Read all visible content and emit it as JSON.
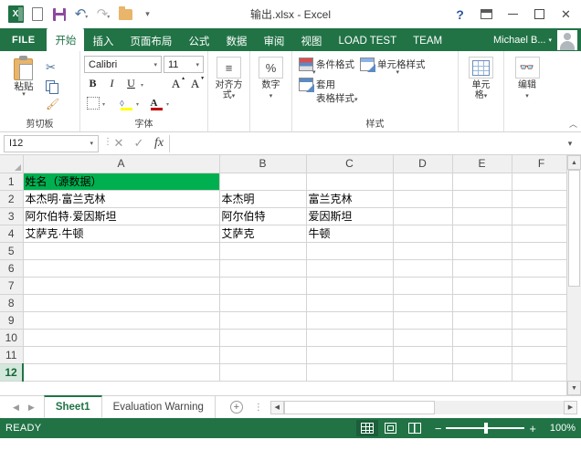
{
  "titlebar": {
    "document_title": "输出.xlsx - Excel",
    "qat": [
      {
        "name": "excel-logo",
        "label": "X"
      },
      {
        "name": "new-file",
        "label": ""
      },
      {
        "name": "save",
        "label": ""
      },
      {
        "name": "undo",
        "label": "↶"
      },
      {
        "name": "redo",
        "label": "↷"
      },
      {
        "name": "open",
        "label": ""
      }
    ],
    "qat_more": "▾",
    "help": "?",
    "minimize": "",
    "maximize": "",
    "close": "✕"
  },
  "ribbon_tabs": {
    "file": "FILE",
    "tabs": [
      {
        "label": "开始",
        "active": true
      },
      {
        "label": "插入",
        "active": false
      },
      {
        "label": "页面布局",
        "active": false
      },
      {
        "label": "公式",
        "active": false
      },
      {
        "label": "数据",
        "active": false
      },
      {
        "label": "审阅",
        "active": false
      },
      {
        "label": "视图",
        "active": false
      },
      {
        "label": "LOAD TEST",
        "active": false
      },
      {
        "label": "TEAM",
        "active": false
      }
    ],
    "account_name": "Michael B...",
    "account_caret": "▾"
  },
  "ribbon": {
    "clipboard": {
      "group_label": "剪切板",
      "paste_label": "粘贴",
      "paste_caret": "▾",
      "cut_glyph": "✂",
      "copy_name": "copy",
      "format_painter_glyph": "🖌",
      "launcher": "◪"
    },
    "font": {
      "group_label": "字体",
      "font_name": "Calibri",
      "font_size": "11",
      "caret": "▾",
      "bold": "B",
      "italic": "I",
      "underline": "U",
      "grow_font": "A",
      "shrink_font": "A",
      "launcher": "◪"
    },
    "alignment": {
      "group_label": "对齐方",
      "group_label2": "式",
      "icon": "≡",
      "caret": "▾"
    },
    "number": {
      "group_label": "数字",
      "icon": "%",
      "caret": "▾"
    },
    "styles": {
      "group_label": "样式",
      "conditional_formatting": "条件格式",
      "format_as_table_line1": "套用",
      "format_as_table_line2": "表格样式",
      "cell_styles": "单元格样式",
      "caret": "▾"
    },
    "cells": {
      "label_line1": "单元",
      "label_line2": "格",
      "caret": "▾"
    },
    "editing": {
      "label": "编辑",
      "icon": "🔍",
      "caret": "▾"
    },
    "collapse_ribbon": "︿"
  },
  "formula_bar": {
    "name_box_value": "I12",
    "name_box_caret": "▾",
    "cancel": "✕",
    "enter": "✓",
    "insert_function": "fx",
    "formula_value": "",
    "expand_caret": "▾",
    "dots": "⋮"
  },
  "grid": {
    "columns": [
      "A",
      "B",
      "C",
      "D",
      "E",
      "F"
    ],
    "rows": [
      {
        "num": "1",
        "selected": false,
        "cells": [
          {
            "value": "姓名（源数据）",
            "green": true
          },
          {
            "value": "",
            "green": false
          },
          {
            "value": "",
            "green": false
          },
          {
            "value": "",
            "green": false
          },
          {
            "value": "",
            "green": false
          },
          {
            "value": "",
            "green": false
          }
        ]
      },
      {
        "num": "2",
        "selected": false,
        "cells": [
          {
            "value": "本杰明·富兰克林",
            "green": false
          },
          {
            "value": "本杰明",
            "green": false
          },
          {
            "value": "富兰克林",
            "green": false
          },
          {
            "value": "",
            "green": false
          },
          {
            "value": "",
            "green": false
          },
          {
            "value": "",
            "green": false
          }
        ]
      },
      {
        "num": "3",
        "selected": false,
        "cells": [
          {
            "value": "阿尔伯特·爱因斯坦",
            "green": false
          },
          {
            "value": "阿尔伯特",
            "green": false
          },
          {
            "value": "爱因斯坦",
            "green": false
          },
          {
            "value": "",
            "green": false
          },
          {
            "value": "",
            "green": false
          },
          {
            "value": "",
            "green": false
          }
        ]
      },
      {
        "num": "4",
        "selected": false,
        "cells": [
          {
            "value": "艾萨克·牛顿",
            "green": false
          },
          {
            "value": "艾萨克",
            "green": false
          },
          {
            "value": "牛顿",
            "green": false
          },
          {
            "value": "",
            "green": false
          },
          {
            "value": "",
            "green": false
          },
          {
            "value": "",
            "green": false
          }
        ]
      },
      {
        "num": "5",
        "selected": false,
        "cells": [
          {
            "value": "",
            "green": false
          },
          {
            "value": "",
            "green": false
          },
          {
            "value": "",
            "green": false
          },
          {
            "value": "",
            "green": false
          },
          {
            "value": "",
            "green": false
          },
          {
            "value": "",
            "green": false
          }
        ]
      },
      {
        "num": "6",
        "selected": false,
        "cells": [
          {
            "value": "",
            "green": false
          },
          {
            "value": "",
            "green": false
          },
          {
            "value": "",
            "green": false
          },
          {
            "value": "",
            "green": false
          },
          {
            "value": "",
            "green": false
          },
          {
            "value": "",
            "green": false
          }
        ]
      },
      {
        "num": "7",
        "selected": false,
        "cells": [
          {
            "value": "",
            "green": false
          },
          {
            "value": "",
            "green": false
          },
          {
            "value": "",
            "green": false
          },
          {
            "value": "",
            "green": false
          },
          {
            "value": "",
            "green": false
          },
          {
            "value": "",
            "green": false
          }
        ]
      },
      {
        "num": "8",
        "selected": false,
        "cells": [
          {
            "value": "",
            "green": false
          },
          {
            "value": "",
            "green": false
          },
          {
            "value": "",
            "green": false
          },
          {
            "value": "",
            "green": false
          },
          {
            "value": "",
            "green": false
          },
          {
            "value": "",
            "green": false
          }
        ]
      },
      {
        "num": "9",
        "selected": false,
        "cells": [
          {
            "value": "",
            "green": false
          },
          {
            "value": "",
            "green": false
          },
          {
            "value": "",
            "green": false
          },
          {
            "value": "",
            "green": false
          },
          {
            "value": "",
            "green": false
          },
          {
            "value": "",
            "green": false
          }
        ]
      },
      {
        "num": "10",
        "selected": false,
        "cells": [
          {
            "value": "",
            "green": false
          },
          {
            "value": "",
            "green": false
          },
          {
            "value": "",
            "green": false
          },
          {
            "value": "",
            "green": false
          },
          {
            "value": "",
            "green": false
          },
          {
            "value": "",
            "green": false
          }
        ]
      },
      {
        "num": "11",
        "selected": false,
        "cells": [
          {
            "value": "",
            "green": false
          },
          {
            "value": "",
            "green": false
          },
          {
            "value": "",
            "green": false
          },
          {
            "value": "",
            "green": false
          },
          {
            "value": "",
            "green": false
          },
          {
            "value": "",
            "green": false
          }
        ]
      },
      {
        "num": "12",
        "selected": true,
        "cells": [
          {
            "value": "",
            "green": false
          },
          {
            "value": "",
            "green": false
          },
          {
            "value": "",
            "green": false
          },
          {
            "value": "",
            "green": false
          },
          {
            "value": "",
            "green": false
          },
          {
            "value": "",
            "green": false
          }
        ]
      }
    ]
  },
  "sheet_tabs": {
    "first_arrow": "◀",
    "prev_arrow": "▶",
    "tabs": [
      {
        "label": "Sheet1",
        "active": true
      },
      {
        "label": "Evaluation Warning",
        "active": false
      }
    ],
    "add_sheet": "+",
    "dots": "⋮",
    "hs_left": "◀",
    "hs_right": "▶"
  },
  "statusbar": {
    "status": "READY",
    "view_normal": "normal-view",
    "view_page_layout": "page-layout-view",
    "view_page_break": "page-break-view",
    "zoom_minus": "−",
    "zoom_plus": "+",
    "zoom_value": "100%"
  },
  "colors": {
    "excel_green": "#217346",
    "cell_highlight_green": "#00b050",
    "accent_blue": "#2b579a"
  }
}
